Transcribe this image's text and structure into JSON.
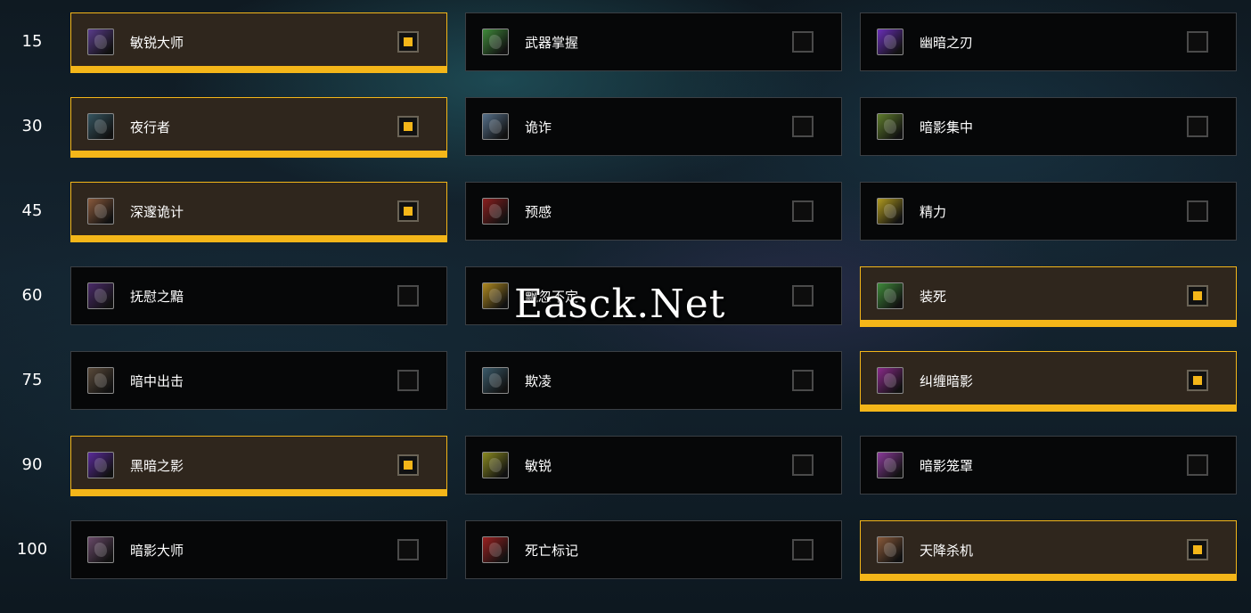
{
  "accent_color": "#f4b619",
  "tiers": [
    {
      "level": "15",
      "talents": [
        {
          "name": "敏锐大师",
          "icon": "master-of-subtlety-icon",
          "color": "#5a3c8c",
          "selected": true
        },
        {
          "name": "武器掌握",
          "icon": "weapon-mastery-icon",
          "color": "#3f8a3a",
          "selected": false
        },
        {
          "name": "幽暗之刃",
          "icon": "gloomblade-icon",
          "color": "#6a2fb8",
          "selected": false
        }
      ]
    },
    {
      "level": "30",
      "talents": [
        {
          "name": "夜行者",
          "icon": "nightstalker-icon",
          "color": "#355560",
          "selected": true
        },
        {
          "name": "诡诈",
          "icon": "subterfuge-icon",
          "color": "#55708a",
          "selected": false
        },
        {
          "name": "暗影集中",
          "icon": "shadow-focus-icon",
          "color": "#5f7d2c",
          "selected": false
        }
      ]
    },
    {
      "level": "45",
      "talents": [
        {
          "name": "深邃诡计",
          "icon": "deeper-stratagem-icon",
          "color": "#8a5a3c",
          "selected": true
        },
        {
          "name": "预感",
          "icon": "anticipation-icon",
          "color": "#8a1e1e",
          "selected": false
        },
        {
          "name": "精力",
          "icon": "vigor-icon",
          "color": "#b09a20",
          "selected": false
        }
      ]
    },
    {
      "level": "60",
      "talents": [
        {
          "name": "抚慰之黯",
          "icon": "soothing-darkness-icon",
          "color": "#4a2a6a",
          "selected": false
        },
        {
          "name": "飘忽不定",
          "icon": "elusiveness-icon",
          "color": "#b08a20",
          "selected": false
        },
        {
          "name": "装死",
          "icon": "cheat-death-icon",
          "color": "#3f8a3a",
          "selected": true
        }
      ]
    },
    {
      "level": "75",
      "talents": [
        {
          "name": "暗中出击",
          "icon": "strike-from-the-shadows-icon",
          "color": "#5a4a3a",
          "selected": false
        },
        {
          "name": "欺凌",
          "icon": "prey-on-the-weak-icon",
          "color": "#3a5a6a",
          "selected": false
        },
        {
          "name": "纠缠暗影",
          "icon": "tangled-shadow-icon",
          "color": "#8a2a8a",
          "selected": true
        }
      ]
    },
    {
      "level": "90",
      "talents": [
        {
          "name": "黑暗之影",
          "icon": "dark-shadow-icon",
          "color": "#5a2a9a",
          "selected": true
        },
        {
          "name": "敏锐",
          "icon": "alacrity-icon",
          "color": "#8a8a20",
          "selected": false
        },
        {
          "name": "暗影笼罩",
          "icon": "enveloping-shadows-icon",
          "color": "#8a3a9a",
          "selected": false
        }
      ]
    },
    {
      "level": "100",
      "talents": [
        {
          "name": "暗影大师",
          "icon": "master-of-shadows-icon",
          "color": "#6a4a6a",
          "selected": false
        },
        {
          "name": "死亡标记",
          "icon": "marked-for-death-icon",
          "color": "#9a2020",
          "selected": false
        },
        {
          "name": "天降杀机",
          "icon": "death-from-above-icon",
          "color": "#8a5a3a",
          "selected": true
        }
      ]
    }
  ],
  "watermark": "Easck.Net"
}
